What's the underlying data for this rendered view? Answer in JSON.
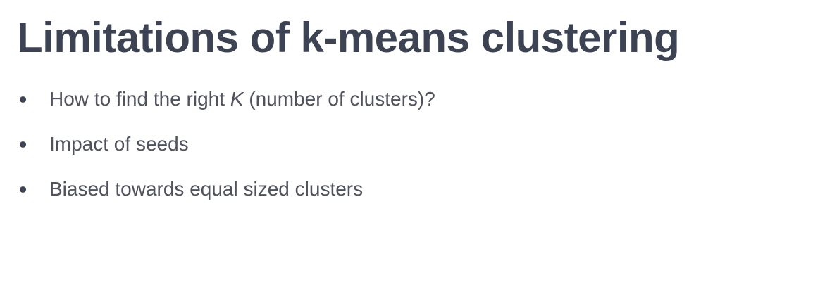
{
  "slide": {
    "title": "Limitations of k-means clustering",
    "bullets": [
      {
        "before": "How to find the right ",
        "emphasis": "K",
        "after": " (number of clusters)?"
      },
      {
        "before": "Impact of seeds",
        "emphasis": "",
        "after": ""
      },
      {
        "before": "Biased towards equal sized clusters",
        "emphasis": "",
        "after": ""
      }
    ]
  },
  "colors": {
    "title": "#3d4352",
    "body_text": "#50535d",
    "bullet": "#3d4352",
    "background": "#ffffff"
  }
}
